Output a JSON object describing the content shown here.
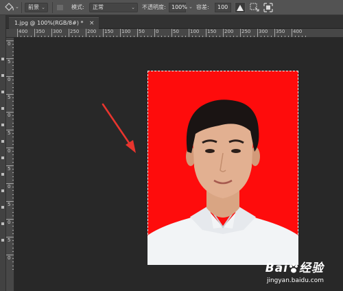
{
  "options_bar": {
    "tool_icon": "paint-bucket-icon",
    "fill_source": "前景",
    "mode_label": "模式:",
    "mode_value": "正常",
    "opacity_label": "不透明度:",
    "opacity_value": "100%",
    "tolerance_label": "容差:",
    "tolerance_value": "100",
    "icons": [
      "anti-alias-icon",
      "contiguous-icon",
      "all-layers-icon"
    ]
  },
  "document_tab": {
    "title": "1.jpg @ 100%(RGB/8#) *",
    "close_label": "×"
  },
  "ruler_top": {
    "labels": [
      "400",
      "350",
      "300",
      "250",
      "200",
      "150",
      "100",
      "50",
      "0",
      "50",
      "100",
      "150",
      "200",
      "250",
      "300",
      "350",
      "400"
    ]
  },
  "ruler_left": {
    "labels": [
      "0",
      "5",
      "0",
      "5",
      "0",
      "5",
      "0",
      "5",
      "0",
      "5",
      "0",
      "5",
      "0"
    ]
  },
  "canvas": {
    "background_color": "#282828",
    "photo_background_color": "#fe0c0c",
    "annotation_arrow_color": "#e8352e"
  },
  "watermark": {
    "brand": "Bai",
    "brand_suffix": "经验",
    "url": "jingyan.baidu.com"
  }
}
